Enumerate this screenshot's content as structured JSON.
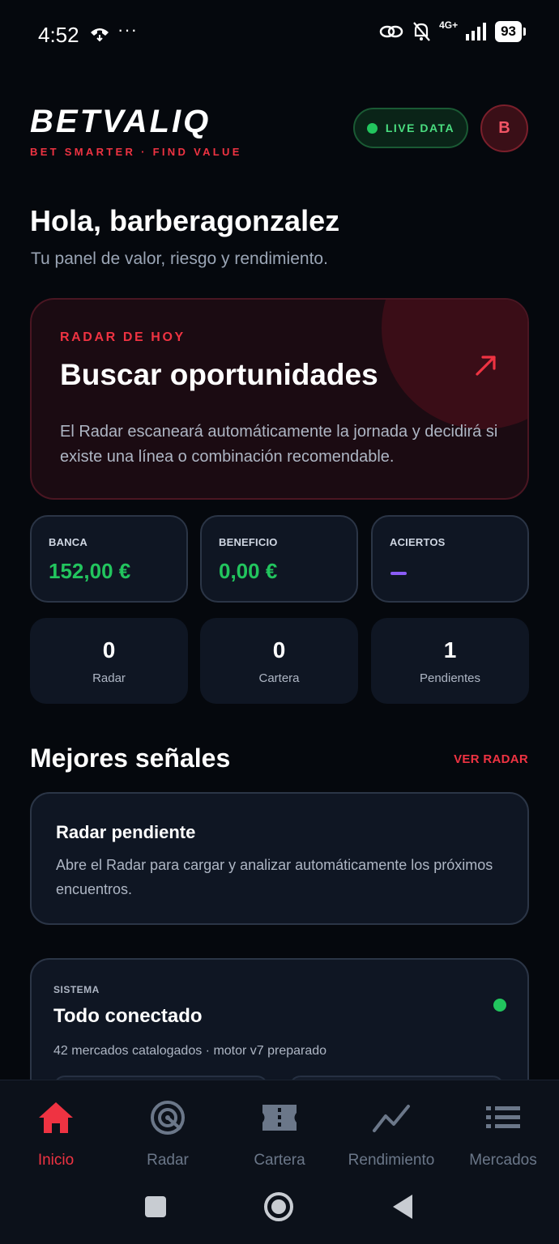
{
  "status_bar": {
    "time": "4:52",
    "dots": "···",
    "network": "4G+",
    "battery": "93"
  },
  "header": {
    "brand": "BETVALIQ",
    "tagline": "BET SMARTER · FIND VALUE",
    "live_badge": "LIVE DATA",
    "avatar_initial": "B"
  },
  "greeting": {
    "title": "Hola, barberagonzalez",
    "subtitle": "Tu panel de valor, riesgo y rendimiento."
  },
  "radar_card": {
    "eyebrow": "RADAR DE HOY",
    "title": "Buscar oportunidades",
    "description": "El Radar escaneará automáticamente la jornada y decidirá si existe una línea o combinación recomendable."
  },
  "stats": [
    {
      "label": "BANCA",
      "value": "152,00 €"
    },
    {
      "label": "BENEFICIO",
      "value": "0,00 €"
    },
    {
      "label": "ACIERTOS",
      "value": ""
    }
  ],
  "counts": [
    {
      "value": "0",
      "label": "Radar"
    },
    {
      "value": "0",
      "label": "Cartera"
    },
    {
      "value": "1",
      "label": "Pendientes"
    }
  ],
  "signals": {
    "title": "Mejores señales",
    "link": "VER RADAR",
    "pending_title": "Radar pendiente",
    "pending_desc": "Abre el Radar para cargar y analizar automáticamente los próximos encuentros."
  },
  "system": {
    "eyebrow": "SISTEMA",
    "title": "Todo conectado",
    "description": "42 mercados catalogados · motor v7 preparado"
  },
  "nav": [
    {
      "label": "Inicio",
      "icon": "home-icon",
      "active": true
    },
    {
      "label": "Radar",
      "icon": "radar-icon"
    },
    {
      "label": "Cartera",
      "icon": "ticket-icon"
    },
    {
      "label": "Rendimiento",
      "icon": "trend-icon"
    },
    {
      "label": "Mercados",
      "icon": "list-icon"
    }
  ],
  "colors": {
    "accent": "#ef3342",
    "positive": "#22c55e",
    "background": "#05080d",
    "card": "#0f1623",
    "purple": "#8b5cf6"
  }
}
